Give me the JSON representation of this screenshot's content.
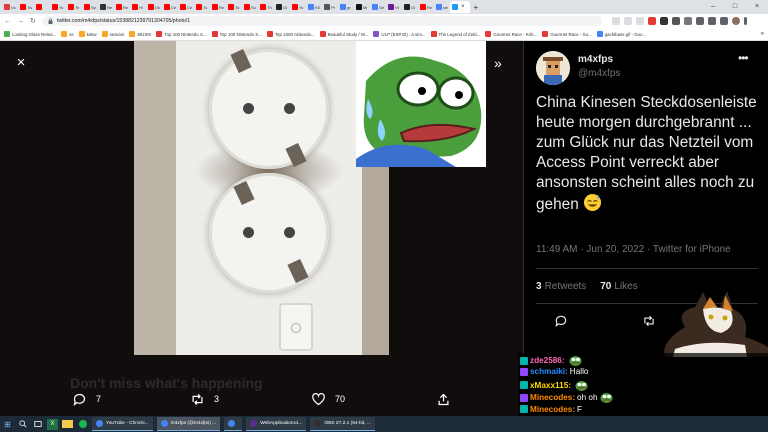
{
  "browser": {
    "tabs": [
      {
        "label": "Vo",
        "color": "#e53935"
      },
      {
        "label": "Tw",
        "color": "#ff0000"
      },
      {
        "label": "",
        "color": "#ff0000"
      },
      {
        "label": "Yo",
        "color": "#ff0000"
      },
      {
        "label": "Te",
        "color": "#ff0000"
      },
      {
        "label": "Sp",
        "color": "#ff0000"
      },
      {
        "label": "Ne",
        "color": "#333333"
      },
      {
        "label": "Re",
        "color": "#ff0000"
      },
      {
        "label": "Hi",
        "color": "#ff0000"
      },
      {
        "label": "Dk",
        "color": "#ff0000"
      },
      {
        "label": "Ce",
        "color": "#ff0000"
      },
      {
        "label": "Ce",
        "color": "#ff0000"
      },
      {
        "label": "To",
        "color": "#ff0000"
      },
      {
        "label": "Re",
        "color": "#ff0000"
      },
      {
        "label": "Ta",
        "color": "#ff0000"
      },
      {
        "label": "Su",
        "color": "#ff0000"
      },
      {
        "label": "Th",
        "color": "#ff0000"
      },
      {
        "label": "Gi",
        "color": "#222222"
      },
      {
        "label": "Yo",
        "color": "#ff0000"
      },
      {
        "label": "KE",
        "color": "#4285f4"
      },
      {
        "label": "Pr",
        "color": "#555555"
      },
      {
        "label": "gr",
        "color": "#4285f4"
      },
      {
        "label": "Ml",
        "color": "#111111"
      },
      {
        "label": "Ge",
        "color": "#4285f4"
      },
      {
        "label": "Vil",
        "color": "#6a1b9a"
      },
      {
        "label": "Gi",
        "color": "#222222"
      },
      {
        "label": "Re",
        "color": "#ff0000"
      },
      {
        "label": "sm",
        "color": "#4285f4"
      }
    ],
    "active_tab_color": "#1d9bf0",
    "active_tab_close": "×",
    "new_tab": "+",
    "window_controls": [
      "–",
      "□",
      "×"
    ],
    "nav": {
      "back": "←",
      "forward": "→",
      "reload": "↻"
    },
    "url": "twitter.com/m4xfps/status/1538821239791304705/photo/1",
    "bookmarks": [
      {
        "label": "Looking Glass Relea...",
        "color": "#4caf50"
      },
      {
        "label": "ss",
        "color": "#f9a825"
      },
      {
        "label": "kekw",
        "color": "#f9a825"
      },
      {
        "label": "session",
        "color": "#f9a825"
      },
      {
        "label": "MUSIK",
        "color": "#f9a825"
      },
      {
        "label": "Top 100 Nintendo S...",
        "color": "#e53935"
      },
      {
        "label": "Top 100 Nintendo S...",
        "color": "#e53935"
      },
      {
        "label": "Top 1000 nintendo...",
        "color": "#e53935"
      },
      {
        "label": "Beautiful Study / W...",
        "color": "#e53935"
      },
      {
        "label": "ULP (ESP32) : a sim...",
        "color": "#7e57c2"
      },
      {
        "label": "The Legend of Zeld...",
        "color": "#e53935"
      },
      {
        "label": "Gourmet Race - Kirb...",
        "color": "#e53935"
      },
      {
        "label": "Gourmet Race - Su...",
        "color": "#e53935"
      },
      {
        "label": "gachibass gif - Goo...",
        "color": "#4285f4"
      }
    ],
    "bookmarks_more": "»"
  },
  "viewer": {
    "close_icon": "×",
    "next_icon": "»",
    "background_ghost_text": "Don't miss what's happening",
    "actions": {
      "replies": "7",
      "retweets": "3",
      "likes": "70"
    }
  },
  "tweet": {
    "author_name": "m4xfps",
    "author_handle": "@m4xfps",
    "more": "•••",
    "text": "China Kinesen Steckdosenleiste heute morgen durchgebrannt ... zum Glück nur das Netzteil vom Access Point verreckt aber ansonsten scheint alles noch zu gehen",
    "meta": "11:49 AM · Jun 20, 2022 · Twitter for iPhone",
    "retweets_count": "3",
    "retweets_label": "Retweets",
    "likes_count": "70",
    "likes_label": "Likes"
  },
  "chat": {
    "messages": [
      {
        "user": "zde2586:",
        "color": "#ff69b4",
        "msg": "",
        "emote": true
      },
      {
        "user": "schmaiki:",
        "color": "#1e90ff",
        "msg": "Hallo",
        "emote": false
      },
      {
        "user": "xMaxx115:",
        "color": "#ffd700",
        "msg": "",
        "emote": true
      },
      {
        "user": "Minecodes:",
        "color": "#ff8c00",
        "msg": "oh oh",
        "emote": true
      },
      {
        "user": "Minecodes:",
        "color": "#ff8c00",
        "msg": "F",
        "emote": false
      }
    ]
  },
  "taskbar": {
    "start_icon": "⊞",
    "apps": [
      {
        "label": "YouTube - Chromi...",
        "color": "#4285f4",
        "active": false
      },
      {
        "label": "m4xfps (@m4xfps) ...",
        "color": "#4285f4",
        "active": true
      },
      {
        "label": "",
        "color": "#4285f4",
        "active": false
      },
      {
        "label": "WebApplication11...",
        "color": "#5c2d91",
        "active": false
      },
      {
        "label": "OBS 27.2.1 (64-bit, ...",
        "color": "#302e31",
        "active": false
      }
    ]
  }
}
